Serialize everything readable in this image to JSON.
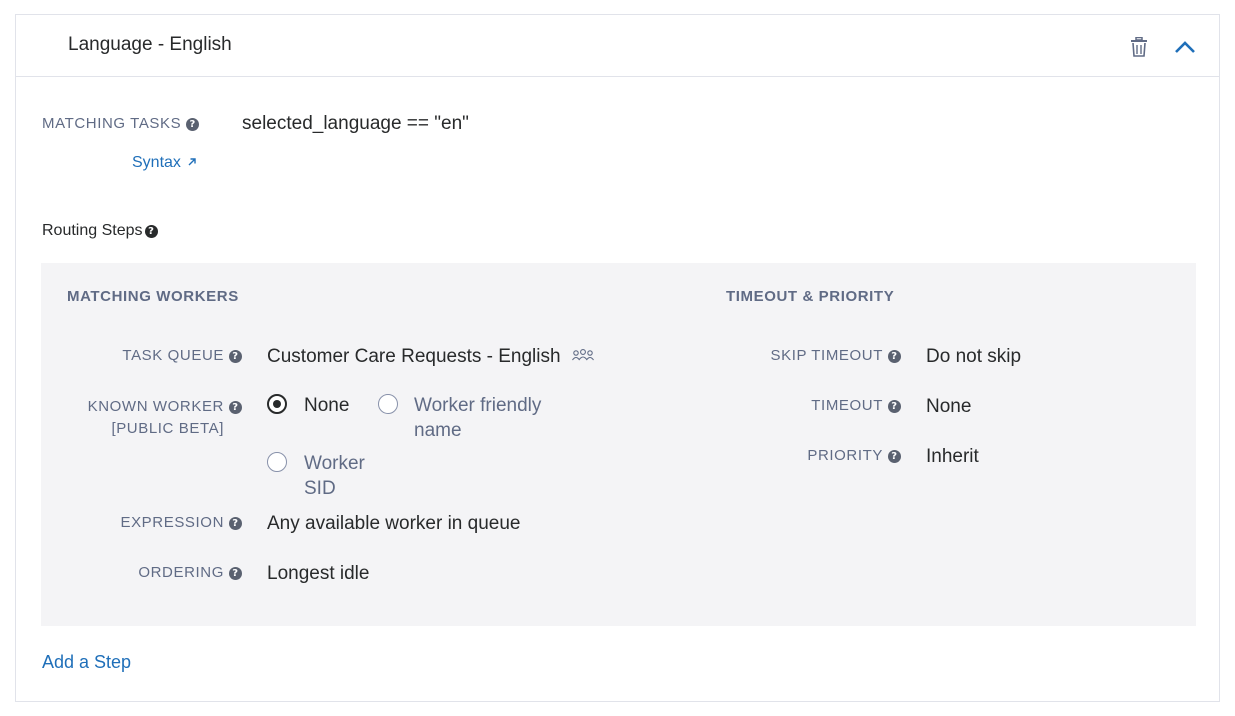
{
  "header": {
    "title": "Language - English",
    "trash_icon": "trash-icon",
    "collapse_icon": "chevron-up-icon",
    "accent_color": "#1f6fb9"
  },
  "matching_tasks": {
    "label": "MATCHING TASKS",
    "value": "selected_language == \"en\"",
    "syntax_link": "Syntax",
    "syntax_icon": "external-arrow-icon"
  },
  "routing_steps": {
    "label": "Routing Steps"
  },
  "step": {
    "matching_workers": {
      "heading": "MATCHING WORKERS",
      "task_queue": {
        "label": "TASK QUEUE",
        "value": "Customer Care Requests - English",
        "icon": "queue-workers-icon"
      },
      "known_worker": {
        "label_line1": "KNOWN WORKER",
        "label_line2": "[PUBLIC BETA]",
        "options": [
          {
            "label": "None",
            "checked": true
          },
          {
            "label_line1": "Worker friendly",
            "label_line2": "name",
            "checked": false
          },
          {
            "label_line1": "Worker",
            "label_line2": "SID",
            "checked": false
          }
        ]
      },
      "expression": {
        "label": "EXPRESSION",
        "value": "Any available worker in queue"
      },
      "ordering": {
        "label": "ORDERING",
        "value": "Longest idle"
      }
    },
    "timeout_priority": {
      "heading": "TIMEOUT & PRIORITY",
      "skip_timeout": {
        "label": "SKIP TIMEOUT",
        "value": "Do not skip"
      },
      "timeout": {
        "label": "TIMEOUT",
        "value": "None"
      },
      "priority": {
        "label": "PRIORITY",
        "value": "Inherit"
      }
    }
  },
  "footer": {
    "add_step": "Add a Step"
  },
  "help_icon_glyph": "?"
}
